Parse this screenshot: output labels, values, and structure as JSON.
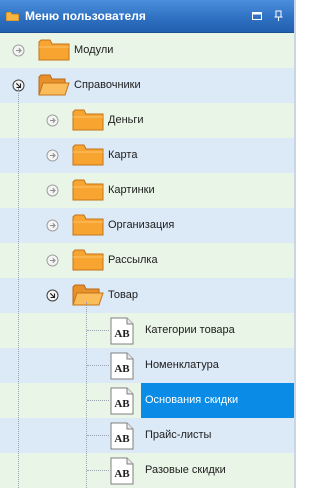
{
  "header": {
    "title": "Меню пользователя"
  },
  "tree": {
    "items": [
      {
        "label": "Модули"
      },
      {
        "label": "Справочники"
      },
      {
        "label": "Деньги"
      },
      {
        "label": "Карта"
      },
      {
        "label": "Картинки"
      },
      {
        "label": "Организация"
      },
      {
        "label": "Рассылка"
      },
      {
        "label": "Товар"
      },
      {
        "label": "Категории товара"
      },
      {
        "label": "Номенклатура"
      },
      {
        "label": "Основания скидки"
      },
      {
        "label": "Прайс-листы"
      },
      {
        "label": "Разовые скидки"
      }
    ]
  },
  "colors": {
    "header": "#2d6fc0",
    "row_green": "#e9f5e6",
    "row_blue": "#dce9f7",
    "selection": "#0a8ce6",
    "folder": "#f5a623"
  },
  "icons": {
    "header_folder": "folder-icon",
    "expand": "expand-arrow-icon",
    "collapse": "collapse-arrow-icon",
    "folder": "folder-icon",
    "report": "report-ab-icon",
    "maximize": "maximize-icon",
    "pin": "pin-icon"
  }
}
